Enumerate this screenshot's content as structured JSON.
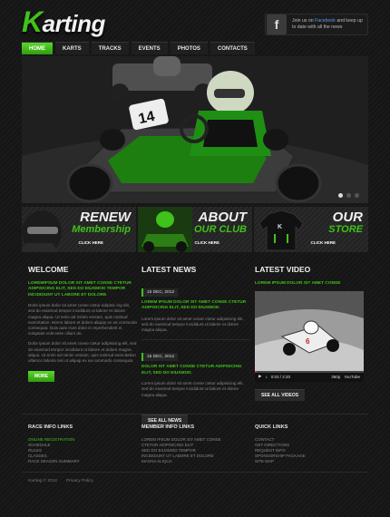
{
  "colors": {
    "accent": "#3fc21a",
    "facebook": "#5aa0e6"
  },
  "header": {
    "logo": {
      "first": "K",
      "rest": "arting"
    },
    "facebook": {
      "icon": "facebook-icon",
      "text_pre": "Join us on ",
      "text_link": "Facebook",
      "text_post": " and keep up to date with all the news"
    }
  },
  "nav": [
    "HOME",
    "KARTS",
    "TRACKS",
    "EVENTS",
    "PHOTOS",
    "CONTACTS"
  ],
  "hero": {
    "kart_number": "14",
    "slides": 3,
    "active_slide": 0
  },
  "banners": [
    {
      "title": "RENEW",
      "subtitle": "Membership",
      "more": "CLICK HERE"
    },
    {
      "title": "ABOUT",
      "subtitle": "OUR CLUB",
      "more": "CLICK HERE"
    },
    {
      "title": "OUR",
      "subtitle": "STORE",
      "more": "CLICK HERE"
    }
  ],
  "welcome": {
    "heading": "WELCOME",
    "intro": "LOREMIPSUM DOLOR SIT AMET CONSE CTETUR ADIPISICING ELIT, SED DO EIUSMOD TEMPOR INCIDIDUNT UT LABORE ET DOLORE",
    "p1": "Dolor ipsum dolor sit amet conse ctetur adipisic ing elit, sed do eiusmod tempor incididunt ut labore et dolore magna aliqua. Ut enim ad minim veniam, quis nostrud exercitation. Nemo labore et dolore aliquip ex ea commodo consequat. Duis aute irure dolor in reprehenderit in voluptate velit esse cillum do.",
    "p2": "Dolor ipsum dolor sit amet conse ctetur adipisicing elit, sed do eiusmod tempor incididunt ut labore et dolore magna aliqua. Ut enim ad minim veniam, quis nostrud exercitation ullamco laboris nisi ut aliquip ex ea commodo consequat.",
    "button": "MORE"
  },
  "news": {
    "heading": "LATEST NEWS",
    "items": [
      {
        "date": "15 DEC, 2012",
        "title": "LOREM IPSUM DOLOR SIT AMET CONSE CTETUR ADIPISICING ELIT, SED DO EIUSMOD.",
        "text": "Lorem ipsum dolor sit amet conse ctetur adipisicing elit, sed do eiusmod tempor incididunt ut labore et dolore magna aliqua."
      },
      {
        "date": "15 DEC, 2012",
        "title": "DOLOR SIT AMET CONSE CTETUR ADIPISICING ELIT, SED DO EIUSMOD.",
        "text": "Lorem ipsum dolor sit amet conse ctetur adipisicing elit, sed do eiusmod tempor incididunt ut labore et dolore magna aliqua."
      }
    ],
    "button": "SEE ALL NEWS"
  },
  "video": {
    "heading": "LATEST VIDEO",
    "caption": "LOREM IPSUM DOLOR SIT AMET CONSE",
    "time": "0:03 / 2:20",
    "quality": "360p",
    "logo": "YouTube",
    "button": "SEE ALL VIDEOS",
    "progress": 0.02
  },
  "footer": {
    "race": {
      "heading": "RACE INFO LINKS",
      "links": [
        "ONLINE REGISTRATION",
        "SCHEDULE",
        "RULES",
        "CLASSES",
        "RACE SEASON SUMMARY"
      ]
    },
    "member": {
      "heading": "MEMBER INFO LINKS",
      "links": [
        "LOREM IPSUM DOLOR SIT AMET CONSE",
        "CTETUR ADIPISICING ELIT",
        "SED DO EIUSMOD TEMPOR",
        "INCIDIDUNT UT LABORE ET DOLORE",
        "MAGNA ALIQUA"
      ]
    },
    "quick": {
      "heading": "QUICK LINKS",
      "links": [
        "CONTACT",
        "GET DIRECTIONS",
        "REQUEST INFO",
        "SPONSORSHIP PACKAGE",
        "SITE MAP"
      ]
    },
    "copyright": "Karting © 2012",
    "privacy": "Privacy Policy"
  }
}
